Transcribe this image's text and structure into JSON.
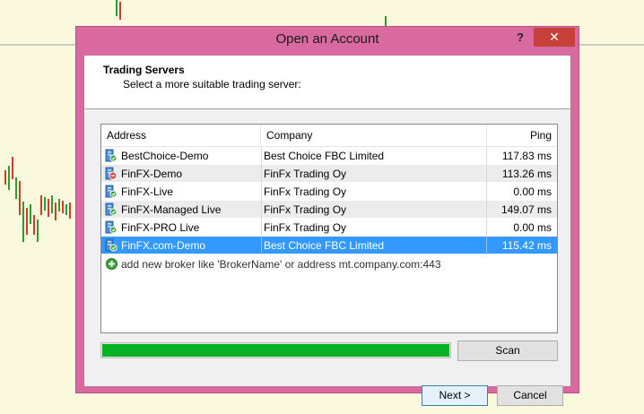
{
  "window": {
    "title": "Open an Account",
    "help_label": "?",
    "close_label": "✕"
  },
  "header": {
    "title": "Trading Servers",
    "subtitle": "Select a more suitable trading server:"
  },
  "table": {
    "columns": [
      "Address",
      "Company",
      "Ping"
    ],
    "rows": [
      {
        "address": "BestChoice-Demo",
        "company": "Best Choice FBC Limited",
        "ping": "117.83 ms",
        "icon": "server-ok-icon"
      },
      {
        "address": "FinFX-Demo",
        "company": "FinFx Trading Oy",
        "ping": "113.26 ms",
        "icon": "server-error-icon"
      },
      {
        "address": "FinFX-Live",
        "company": "FinFx Trading Oy",
        "ping": "0.00 ms",
        "icon": "server-ok-icon"
      },
      {
        "address": "FinFX-Managed Live",
        "company": "FinFx Trading Oy",
        "ping": "149.07 ms",
        "icon": "server-ok-icon"
      },
      {
        "address": "FinFX-PRO Live",
        "company": "FinFx Trading Oy",
        "ping": "0.00 ms",
        "icon": "server-ok-icon"
      },
      {
        "address": "FinFX.com-Demo",
        "company": "Best Choice FBC Limited",
        "ping": "115.42 ms",
        "icon": "server-ok-icon",
        "selected": true
      }
    ],
    "add_broker_text": "add new broker like 'BrokerName' or address mt.company.com:443"
  },
  "scan_progress": 1.0,
  "buttons": {
    "scan": "Scan",
    "next": "Next >",
    "cancel": "Cancel"
  },
  "colors": {
    "window_frame": "#d96aa0",
    "selection": "#3399ff",
    "progress": "#06b025",
    "chart_background": "#fbf9dd"
  }
}
